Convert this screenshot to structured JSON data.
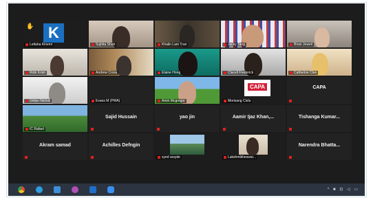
{
  "participants": [
    {
      "name": "Letlaha Kinemi",
      "mode": "logo",
      "logo_text": "K",
      "hand_raised": true
    },
    {
      "name": "Sujhita Shah",
      "mode": "video"
    },
    {
      "name": "Khalin Lam Tran",
      "mode": "video"
    },
    {
      "name": "Jacky Tang",
      "mode": "video"
    },
    {
      "name": "Brian Jeweil",
      "mode": "video"
    },
    {
      "name": "Robi Kristi",
      "mode": "video"
    },
    {
      "name": "Andrew Cross",
      "mode": "video"
    },
    {
      "name": "Elaine Hong",
      "mode": "video"
    },
    {
      "name": "Clacell Frederick",
      "mode": "video"
    },
    {
      "name": "Catherine Cleo",
      "mode": "video"
    },
    {
      "name": "Unilyn Nicholl",
      "mode": "video"
    },
    {
      "name": "Evans M (PWA)",
      "mode": "blank"
    },
    {
      "name": "Amin Mcgregor",
      "mode": "video"
    },
    {
      "name": "Morisang Ciolu",
      "mode": "logo",
      "logo_text": "CAPA"
    },
    {
      "name": "CAPA",
      "mode": "text"
    },
    {
      "name": "IC Rafael",
      "mode": "video"
    },
    {
      "name": "Sajid Hussain",
      "mode": "text"
    },
    {
      "name": "yao jin",
      "mode": "text"
    },
    {
      "name": "Aamir Ijaz Khan,...",
      "mode": "text"
    },
    {
      "name": "Tishanga Kumar...",
      "mode": "text"
    },
    {
      "name": "Akram samad",
      "mode": "text"
    },
    {
      "name": "Achilles Defngin",
      "mode": "text"
    },
    {
      "name": "syed arsyde",
      "mode": "video"
    },
    {
      "name": "Lakshmikheswar...",
      "mode": "video"
    },
    {
      "name": "Narendra Bhatta...",
      "mode": "text"
    }
  ],
  "taskbar": {
    "icons": [
      "chrome-icon",
      "edge-icon",
      "files-icon",
      "app-icon",
      "outlook-icon",
      "zoom-icon"
    ],
    "tray": "^ ■ ⊡ ◁ ▭"
  },
  "colors": {
    "meeting_bg": "#1c1c1c",
    "mic_muted": "#e02020",
    "taskbar": "#2b3440"
  }
}
